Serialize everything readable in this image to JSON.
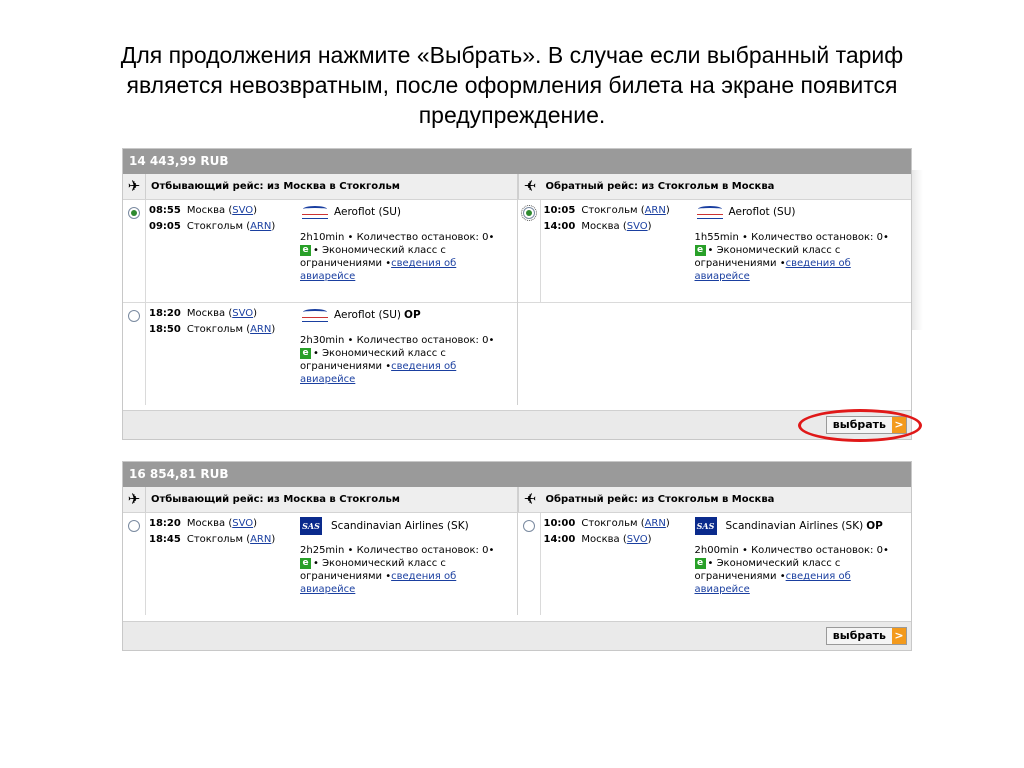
{
  "caption": {
    "line1": "Для продолжения нажмите «Выбрать». В случае если выбранный тариф",
    "line2": "является невозвратным, после оформления билета на экране появится",
    "line3": "предупреждение."
  },
  "offers": [
    {
      "price": "14 443,99 RUB",
      "outbound": {
        "title": "Отбывающий рейс: из Москва в Стокгольм",
        "options": [
          {
            "selected": true,
            "dep_time": "08:55",
            "dep_city": "Москва (",
            "dep_code": "SVO",
            "arr_time": "09:05",
            "arr_city": "Стокгольм (",
            "arr_code": "ARN",
            "airline": "Aeroflot (SU)",
            "op": "",
            "duration": "2h10min",
            "stops": "Количество остановок: 0",
            "fare_class": "Экономический класс с ограничениями",
            "details_link": "сведения об авиарейсе"
          },
          {
            "selected": false,
            "dep_time": "18:20",
            "dep_city": "Москва (",
            "dep_code": "SVO",
            "arr_time": "18:50",
            "arr_city": "Стокгольм (",
            "arr_code": "ARN",
            "airline": "Aeroflot (SU)",
            "op": "OP",
            "duration": "2h30min",
            "stops": "Количество остановок: 0",
            "fare_class": "Экономический класс с ограничениями",
            "details_link": "сведения об авиарейсе"
          }
        ]
      },
      "return": {
        "title": "Обратный рейс: из Стокгольм в Москва",
        "options": [
          {
            "selected": true,
            "dep_time": "10:05",
            "dep_city": "Стокгольм (",
            "dep_code": "ARN",
            "arr_time": "14:00",
            "arr_city": "Москва (",
            "arr_code": "SVO",
            "airline": "Aeroflot (SU)",
            "op": "",
            "duration": "1h55min",
            "stops": "Количество остановок: 0",
            "fare_class": "Экономический класс с ограничениями",
            "details_link": "сведения об авиарейсе"
          }
        ]
      },
      "select_label": "выбрать",
      "select_arrow": ">"
    },
    {
      "price": "16 854,81 RUB",
      "outbound": {
        "title": "Отбывающий рейс: из Москва в Стокгольм",
        "options": [
          {
            "selected": false,
            "dep_time": "18:20",
            "dep_city": "Москва (",
            "dep_code": "SVO",
            "arr_time": "18:45",
            "arr_city": "Стокгольм (",
            "arr_code": "ARN",
            "airline": "Scandinavian Airlines (SK)",
            "op": "",
            "duration": "2h25min",
            "stops": "Количество остановок: 0",
            "fare_class": "Экономический класс с ограничениями",
            "details_link": "сведения об авиарейсе"
          }
        ]
      },
      "return": {
        "title": "Обратный рейс: из Стокгольм в Москва",
        "options": [
          {
            "selected": false,
            "dep_time": "10:00",
            "dep_city": "Стокгольм (",
            "dep_code": "ARN",
            "arr_time": "14:00",
            "arr_city": "Москва (",
            "arr_code": "SVO",
            "airline": "Scandinavian Airlines (SK)",
            "op": "OP",
            "duration": "2h00min",
            "stops": "Количество остановок: 0",
            "fare_class": "Экономический класс с ограничениями",
            "details_link": "сведения об авиарейсе"
          }
        ]
      },
      "select_label": "выбрать",
      "select_arrow": ">"
    }
  ],
  "logos": {
    "aeroflot_text": "AEROFLOT",
    "sas_text": "SAS"
  },
  "icons": {
    "outbound": "airplane-icon",
    "return": "airplane-icon"
  },
  "colors": {
    "price_bar": "#9a9a9a",
    "select_arrow": "#f39a1c",
    "highlight": "#e01818",
    "fare_badge": "#28a028",
    "link": "#1a3fa0"
  }
}
